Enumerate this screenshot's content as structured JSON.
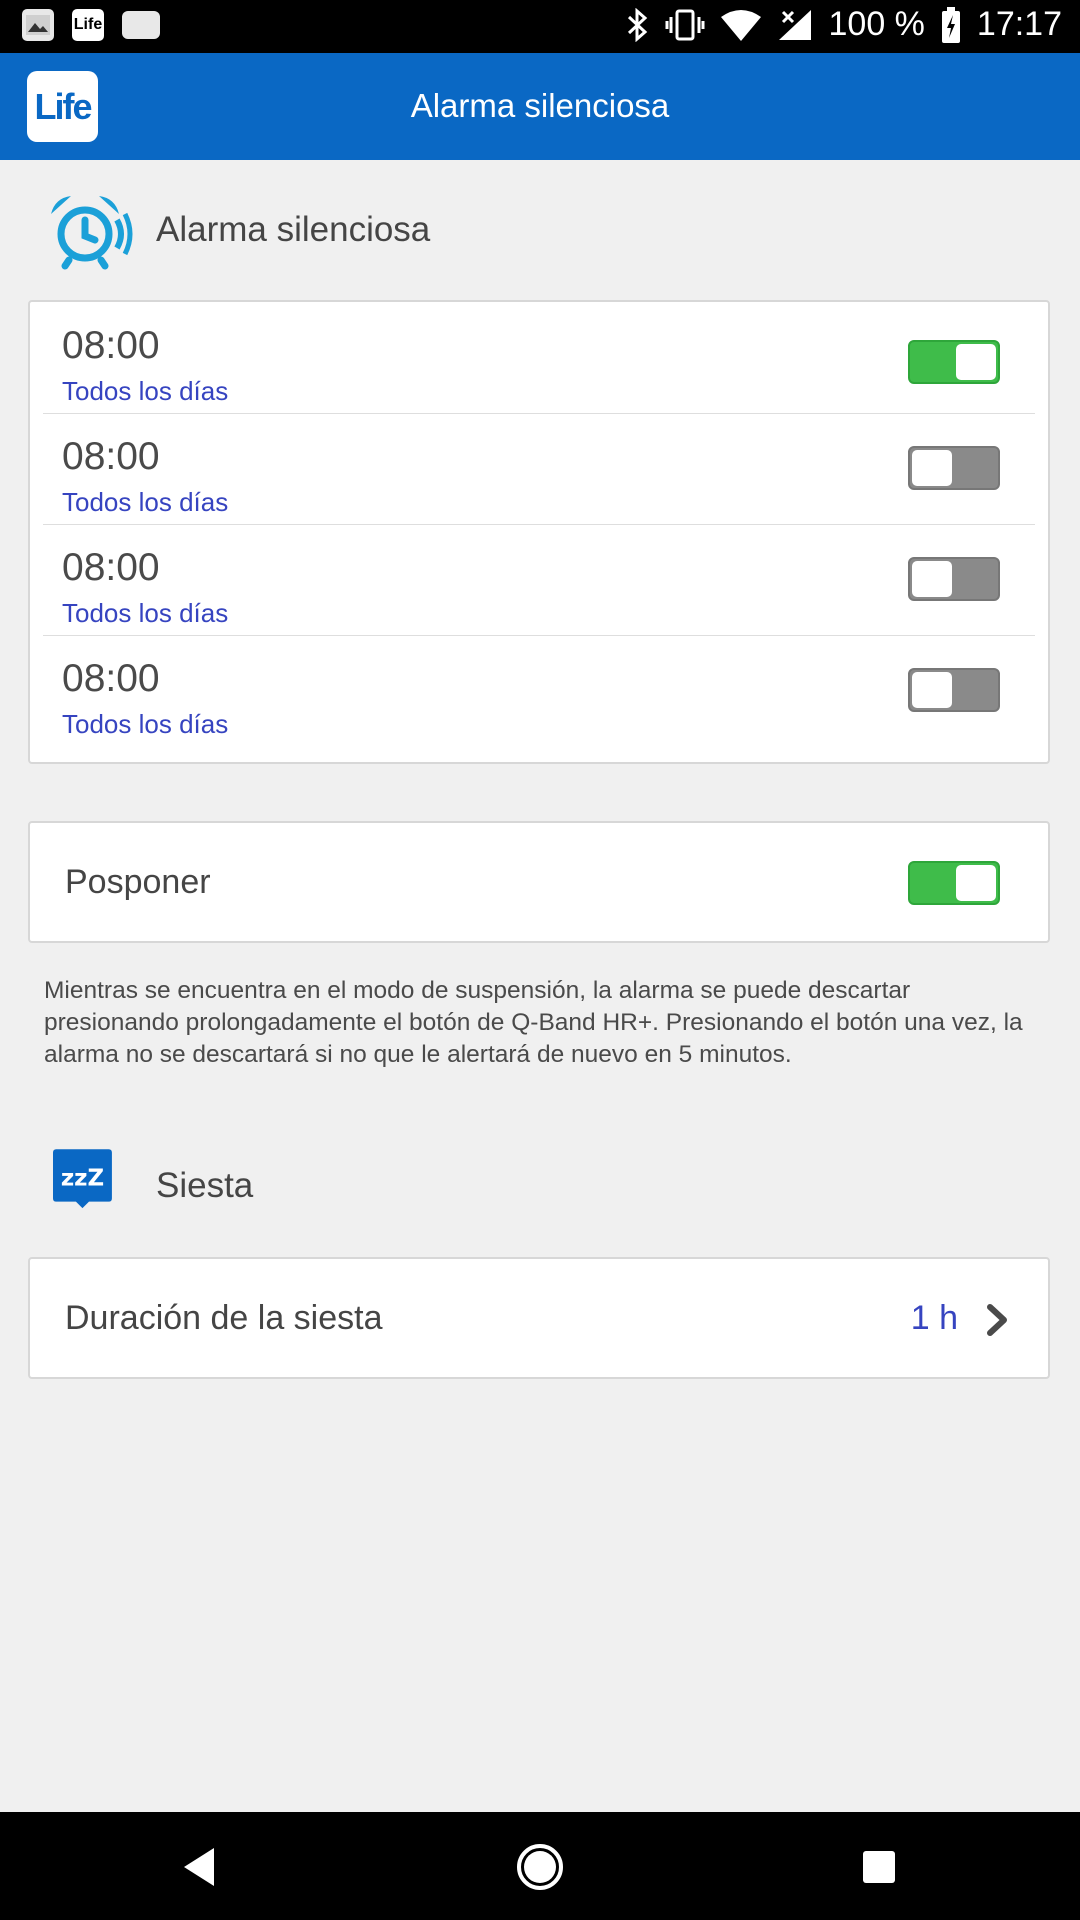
{
  "status_bar": {
    "battery": "100 %",
    "time": "17:17",
    "notif_life": "Life"
  },
  "app_bar": {
    "logo_text": "Life",
    "title": "Alarma silenciosa"
  },
  "alarm_section": {
    "title": "Alarma silenciosa",
    "icon": "alarm-clock-icon",
    "alarms": [
      {
        "time": "08:00",
        "days": "Todos los días",
        "enabled": true
      },
      {
        "time": "08:00",
        "days": "Todos los días",
        "enabled": false
      },
      {
        "time": "08:00",
        "days": "Todos los días",
        "enabled": false
      },
      {
        "time": "08:00",
        "days": "Todos los días",
        "enabled": false
      }
    ]
  },
  "snooze": {
    "label": "Posponer",
    "enabled": true,
    "description": "Mientras se encuentra en el modo de suspensión, la alarma se puede descartar presionando prolongadamente el botón de Q-Band HR+. Presionando el botón una vez, la alarma no se descartará si no que le alertará de nuevo en 5 minutos."
  },
  "nap_section": {
    "title": "Siesta",
    "icon": "zzz-icon",
    "duration_label": "Duración de la siesta",
    "duration_value": "1 h"
  },
  "colors": {
    "app_bar": "#0a68c4",
    "toggle_on": "#3fbc4a",
    "toggle_off": "#8a8a8a",
    "accent_text": "#3644c0",
    "alarm_icon": "#1ba0d8"
  }
}
